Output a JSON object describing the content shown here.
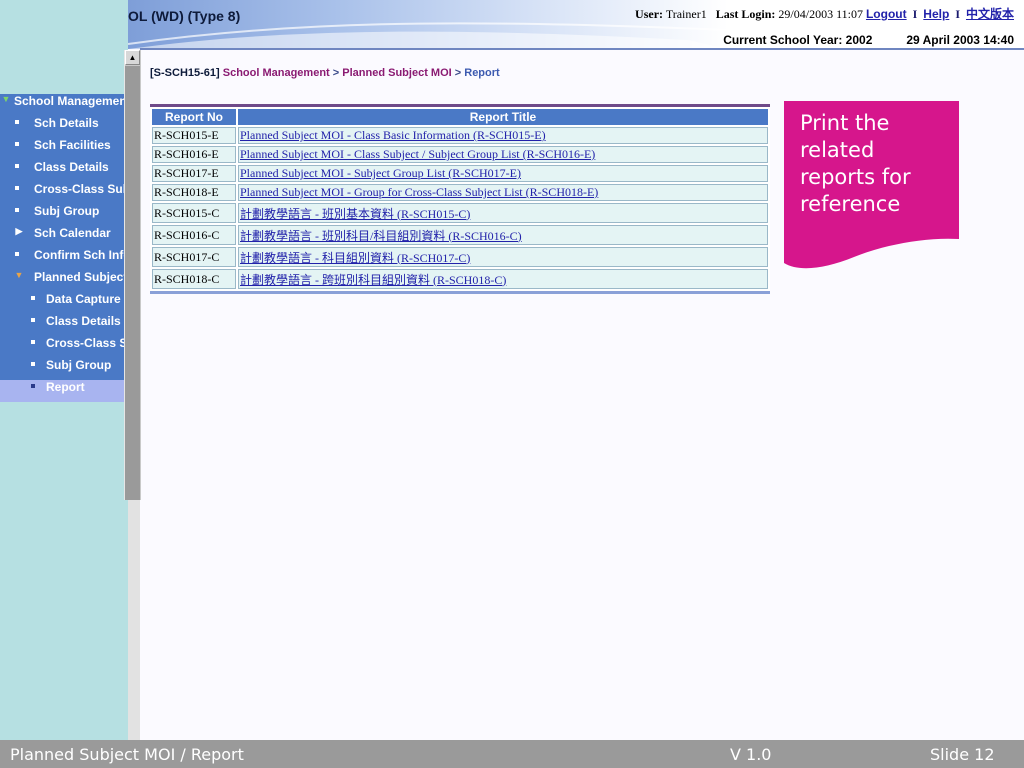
{
  "header": {
    "title": "OL (WD) (Type 8)",
    "user_label": "User:",
    "user_name": "Trainer1",
    "last_login_label": "Last Login:",
    "last_login_value": "29/04/2003 11:07",
    "logout_label": "Logout",
    "help_label": "Help",
    "chinese_label": "中文版本",
    "school_year": "Current School Year: 2002",
    "date_time": "29 April 2003 14:40"
  },
  "sidebar": {
    "items": [
      {
        "label": "School Managemen",
        "icon": "triangle-down-green"
      },
      {
        "label": "Sch Details",
        "icon": "bullet"
      },
      {
        "label": "Sch Facilities",
        "icon": "bullet"
      },
      {
        "label": "Class Details",
        "icon": "bullet"
      },
      {
        "label": "Cross-Class Sul",
        "icon": "bullet"
      },
      {
        "label": "Subj Group",
        "icon": "bullet"
      },
      {
        "label": "Sch Calendar",
        "icon": "triangle-right"
      },
      {
        "label": "Confirm Sch Info",
        "icon": "bullet"
      },
      {
        "label": "Planned Subject",
        "icon": "triangle-down-orange"
      },
      {
        "label": "Data Capture",
        "icon": "bullet"
      },
      {
        "label": "Class Details",
        "icon": "bullet"
      },
      {
        "label": "Cross-Class S",
        "icon": "bullet"
      },
      {
        "label": "Subj Group",
        "icon": "bullet"
      },
      {
        "label": "Report",
        "icon": "bullet"
      }
    ]
  },
  "breadcrumb": {
    "code": "[S-SCH15-61]",
    "section": "School Management",
    "sep1": ">",
    "sub": "Planned Subject MOI",
    "sep2": ">",
    "current": "Report"
  },
  "table": {
    "headers": [
      "Report No",
      "Report Title"
    ],
    "rows": [
      {
        "no": "R-SCH015-E",
        "title": "Planned Subject MOI - Class Basic Information (R-SCH015-E)"
      },
      {
        "no": "R-SCH016-E",
        "title": "Planned Subject MOI - Class Subject / Subject Group List (R-SCH016-E)"
      },
      {
        "no": "R-SCH017-E",
        "title": "Planned Subject MOI - Subject Group List (R-SCH017-E)"
      },
      {
        "no": "R-SCH018-E",
        "title": "Planned Subject MOI - Group for Cross-Class Subject List (R-SCH018-E)"
      },
      {
        "no": "R-SCH015-C",
        "title": "計劃教學語言 - 班別基本資料 (R-SCH015-C)"
      },
      {
        "no": "R-SCH016-C",
        "title": "計劃教學語言 - 班別科目/科目組別資料 (R-SCH016-C)"
      },
      {
        "no": "R-SCH017-C",
        "title": "計劃教學語言 - 科目組別資料 (R-SCH017-C)"
      },
      {
        "no": "R-SCH018-C",
        "title": "計劃教學語言 - 跨班別科目組別資料 (R-SCH018-C)"
      }
    ]
  },
  "callout": {
    "text": "Print the related reports for reference",
    "color": "#d6168c"
  },
  "footer": {
    "left": "Planned Subject MOI / Report",
    "version": "V 1.0",
    "slide": "Slide 12"
  }
}
